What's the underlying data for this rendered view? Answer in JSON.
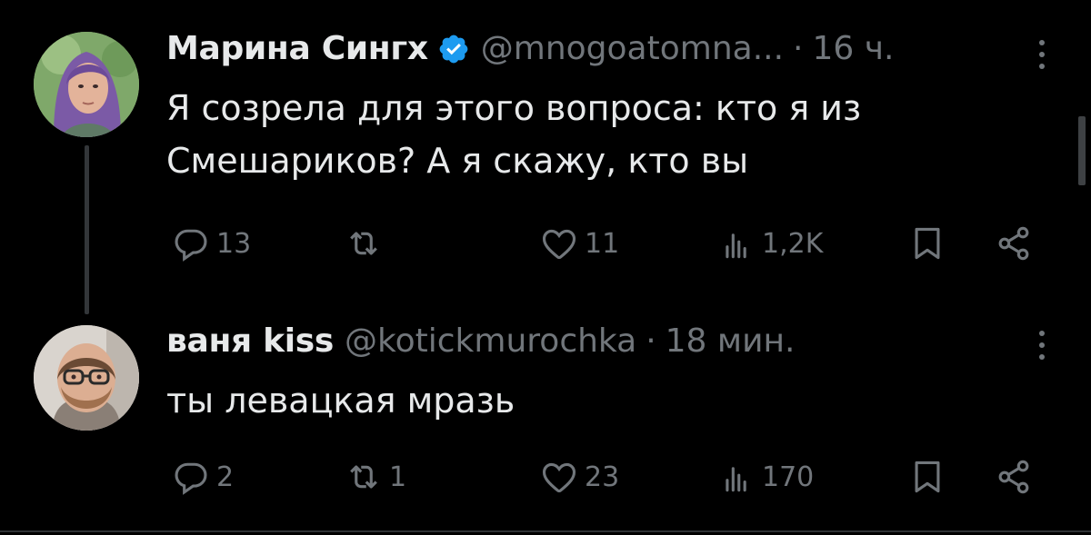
{
  "tweets": [
    {
      "author_name": "Марина Сингх",
      "verified": true,
      "handle": "@mnogoatomna...",
      "separator": "·",
      "time": "16 ч.",
      "text_lines": [
        "Я созрела для этого вопроса: кто я из",
        "Смешариков? А я скажу, кто вы"
      ],
      "replies": "13",
      "retweets": "",
      "likes": "11",
      "views": "1,2K"
    },
    {
      "author_name": "ваня kiss",
      "verified": false,
      "handle": "@kotickmurochka",
      "separator": "·",
      "time": "18 мин.",
      "text_lines": [
        "ты левацкая мразь"
      ],
      "replies": "2",
      "retweets": "1",
      "likes": "23",
      "views": "170"
    }
  ],
  "colors": {
    "background": "#000000",
    "text_primary": "#e7e9ea",
    "text_secondary": "#71767b",
    "verified_badge": "#1d9bf0",
    "thread_line": "#333639"
  },
  "icons": [
    "reply-icon",
    "retweet-icon",
    "like-icon",
    "views-icon",
    "bookmark-icon",
    "share-icon",
    "more-icon",
    "verified-badge-icon"
  ]
}
